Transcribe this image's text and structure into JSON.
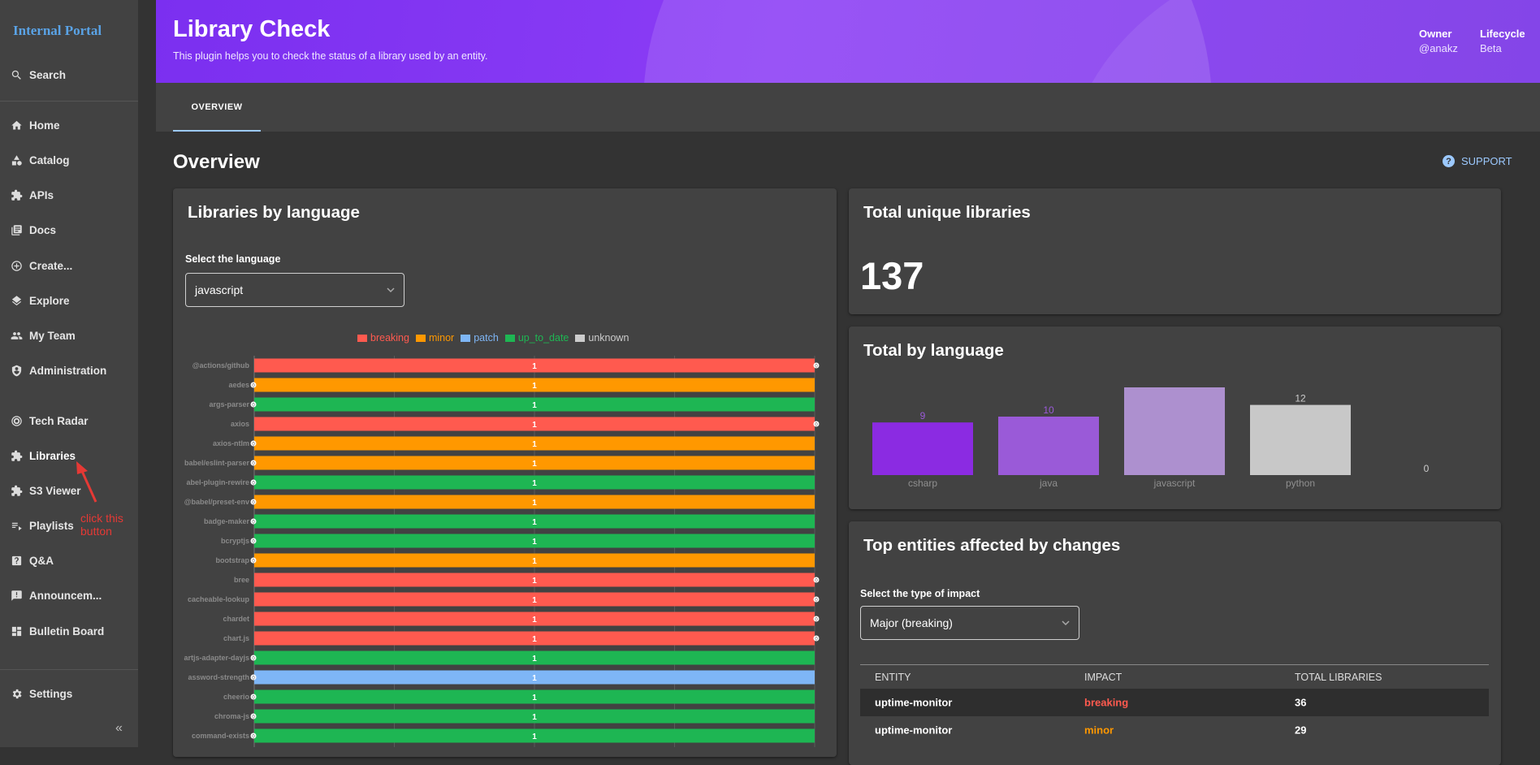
{
  "app": {
    "title": "Internal Portal"
  },
  "sidebar": {
    "search_label": "Search",
    "items": [
      {
        "label": "Home",
        "icon": "home-icon"
      },
      {
        "label": "Catalog",
        "icon": "category-icon"
      },
      {
        "label": "APIs",
        "icon": "puzzle-icon"
      },
      {
        "label": "Docs",
        "icon": "library-books-icon"
      },
      {
        "label": "Create...",
        "icon": "add-circle-icon"
      },
      {
        "label": "Explore",
        "icon": "layers-icon"
      },
      {
        "label": "My Team",
        "icon": "people-icon"
      },
      {
        "label": "Administration",
        "icon": "admin-icon"
      },
      {
        "label": "Tech Radar",
        "icon": "radar-icon"
      },
      {
        "label": "Libraries",
        "icon": "puzzle-icon"
      },
      {
        "label": "S3 Viewer",
        "icon": "puzzle-icon"
      },
      {
        "label": "Playlists",
        "icon": "playlist-icon"
      },
      {
        "label": "Q&A",
        "icon": "help-box-icon"
      },
      {
        "label": "Announcem...",
        "icon": "announcement-icon"
      },
      {
        "label": "Bulletin Board",
        "icon": "dashboard-icon"
      }
    ],
    "settings_label": "Settings",
    "collapse_glyph": "«",
    "annotation": "click this button"
  },
  "header": {
    "title": "Library Check",
    "subtitle": "This plugin helps you to check the status of a library used by an entity.",
    "owner_label": "Owner",
    "owner_value": "@anakz",
    "lifecycle_label": "Lifecycle",
    "lifecycle_value": "Beta"
  },
  "tabs": [
    {
      "label": "OVERVIEW"
    }
  ],
  "overview": {
    "title": "Overview",
    "support_label": "SUPPORT"
  },
  "libraries_by_language": {
    "title": "Libraries by language",
    "select_label": "Select the language",
    "selected": "javascript"
  },
  "total_unique": {
    "title": "Total unique libraries",
    "value": "137"
  },
  "total_by_language": {
    "title": "Total by language"
  },
  "top_entities": {
    "title": "Top entities affected by changes",
    "select_label": "Select the type of impact",
    "selected": "Major (breaking)",
    "columns": [
      "ENTITY",
      "IMPACT",
      "TOTAL LIBRARIES"
    ],
    "rows": [
      {
        "entity": "uptime-monitor",
        "impact": "breaking",
        "total": "36"
      },
      {
        "entity": "uptime-monitor",
        "impact": "minor",
        "total": "29"
      }
    ]
  },
  "colors": {
    "breaking": "#ff5a4f",
    "minor": "#ff9800",
    "patch": "#7eb6f6",
    "up_to_date": "#1eb653",
    "unknown": "#cccccc",
    "accent": "#8b3df5"
  },
  "chart_data": [
    {
      "type": "bar",
      "orientation": "horizontal",
      "stacked": true,
      "legend": [
        "breaking",
        "minor",
        "patch",
        "up_to_date",
        "unknown"
      ],
      "legend_position": "top",
      "categories": [
        "@actions/github",
        "aedes",
        "args-parser",
        "axios",
        "axios-ntlm",
        "babel/eslint-parser",
        "abel-plugin-rewire",
        "@babel/preset-env",
        "badge-maker",
        "bcryptjs",
        "bootstrap",
        "bree",
        "cacheable-lookup",
        "chardet",
        "chart.js",
        "artjs-adapter-dayjs",
        "assword-strength",
        "cheerio",
        "chroma-js",
        "command-exists"
      ],
      "status": [
        "breaking",
        "minor",
        "up_to_date",
        "breaking",
        "minor",
        "minor",
        "up_to_date",
        "minor",
        "up_to_date",
        "up_to_date",
        "minor",
        "breaking",
        "breaking",
        "breaking",
        "breaking",
        "up_to_date",
        "patch",
        "up_to_date",
        "up_to_date",
        "up_to_date"
      ],
      "values": [
        1,
        1,
        1,
        1,
        1,
        1,
        1,
        1,
        1,
        1,
        1,
        1,
        1,
        1,
        1,
        1,
        1,
        1,
        1,
        1
      ],
      "zero_label": "0",
      "xlim": [
        0,
        1
      ],
      "grid": true
    },
    {
      "type": "bar",
      "categories": [
        "csharp",
        "java",
        "javascript",
        "python",
        ""
      ],
      "values": [
        9,
        10,
        15,
        12,
        0
      ],
      "value_labels": [
        "9",
        "10",
        "",
        "12",
        "0"
      ],
      "colors": [
        "#8b2be2",
        "#9a5ad8",
        "#ad90cf",
        "#c8c8c8",
        "#c8c8c8"
      ],
      "label_colors": [
        "#9a5ad8",
        "#9a5ad8",
        "#ad90cf",
        "#cccccc",
        "#cccccc"
      ],
      "ylim": [
        0,
        15
      ],
      "grid": false
    }
  ]
}
